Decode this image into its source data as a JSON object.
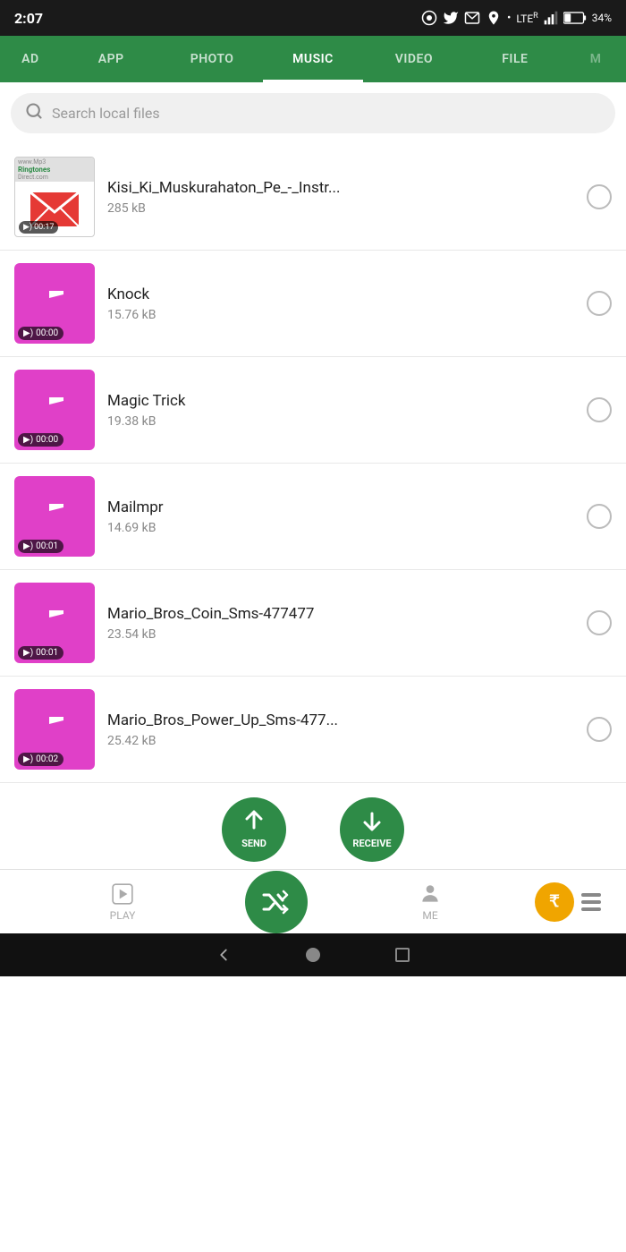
{
  "statusBar": {
    "time": "2:07",
    "battery": "34%",
    "signal": "LTE"
  },
  "navTabs": {
    "items": [
      {
        "label": "AD",
        "active": false
      },
      {
        "label": "APP",
        "active": false
      },
      {
        "label": "PHOTO",
        "active": false
      },
      {
        "label": "MUSIC",
        "active": true
      },
      {
        "label": "VIDEO",
        "active": false
      },
      {
        "label": "FILE",
        "active": false
      }
    ]
  },
  "search": {
    "placeholder": "Search local files"
  },
  "files": [
    {
      "name": "Kisi_Ki_Muskurahaton_Pe_-_Instr...",
      "size": "285 kB",
      "type": "ringtones",
      "duration": "00:17"
    },
    {
      "name": "Knock",
      "size": "15.76 kB",
      "type": "music",
      "duration": "00:00"
    },
    {
      "name": "Magic Trick",
      "size": "19.38 kB",
      "type": "music",
      "duration": "00:00"
    },
    {
      "name": "Mailmpr",
      "size": "14.69 kB",
      "type": "music",
      "duration": "00:01"
    },
    {
      "name": "Mario_Bros_Coin_Sms-477477",
      "size": "23.54 kB",
      "type": "music",
      "duration": "00:01"
    },
    {
      "name": "Mario_Bros_Power_Up_Sms-477...",
      "size": "25.42 kB",
      "type": "music",
      "duration": "00:02"
    }
  ],
  "actionButtons": {
    "send": "SEND",
    "receive": "RECEIVE"
  },
  "bottomNav": {
    "play": "PLAY",
    "me": "ME"
  }
}
